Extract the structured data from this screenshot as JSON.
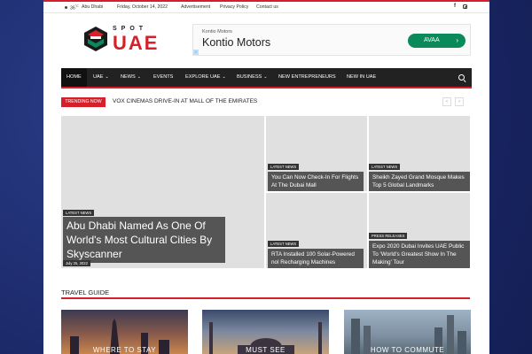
{
  "topbar": {
    "temperature": "36",
    "temp_unit": "°C",
    "city": "Abu Dhabi",
    "date": "Friday, October 14, 2022",
    "links": [
      "Advertisement",
      "Privacy Policy",
      "Contact us"
    ],
    "social_icons": [
      "facebook-icon",
      "instagram-icon"
    ]
  },
  "logo": {
    "top": "SPOT",
    "main": "UAE"
  },
  "ad": {
    "brand_small": "Kontio Motors",
    "brand_big": "Kontio Motors",
    "button": "AVAA",
    "info": "i"
  },
  "nav": {
    "items": [
      {
        "label": "HOME",
        "active": true,
        "dropdown": false
      },
      {
        "label": "UAE",
        "dropdown": true
      },
      {
        "label": "NEWS",
        "dropdown": true
      },
      {
        "label": "EVENTS",
        "dropdown": false
      },
      {
        "label": "EXPLORE UAE",
        "dropdown": true
      },
      {
        "label": "BUSINESS",
        "dropdown": true
      },
      {
        "label": "NEW ENTREPRENEURS",
        "dropdown": false
      },
      {
        "label": "NEW IN UAE",
        "dropdown": false
      }
    ]
  },
  "trending": {
    "badge": "TRENDING NOW",
    "headline": "VOX CINEMAS DRIVE-IN AT MALL OF THE EMIRATES",
    "prev": "‹",
    "next": "›"
  },
  "grid": {
    "main": {
      "category": "LATEST NEWS",
      "title": "Abu Dhabi Named As One Of World's Most Cultural Cities By Skyscanner",
      "date": "July 25, 2022"
    },
    "side": [
      {
        "category": "LATEST NEWS",
        "title": "You Can Now Check-In For Flights At The Dubai Mall"
      },
      {
        "category": "LATEST NEWS",
        "title": "Sheikh Zayed Grand Mosque Makes Top 5 Global Landmarks"
      },
      {
        "category": "LATEST NEWS",
        "title": "RTA Installed 100 Solar-Powered nol Recharging Machines"
      },
      {
        "category": "PRESS RELEASES",
        "title": "Expo 2020 Dubai Invites UAE Public To 'World's Greatest Show In The Making' Tour"
      }
    ]
  },
  "travel": {
    "title": "TRAVEL GUIDE",
    "cards": [
      "WHERE TO STAY",
      "MUST SEE",
      "HOW TO COMMUTE"
    ]
  },
  "colors": {
    "accent": "#d51f2a",
    "nav_bg": "#222222",
    "ad_button": "#0a8a5a"
  }
}
